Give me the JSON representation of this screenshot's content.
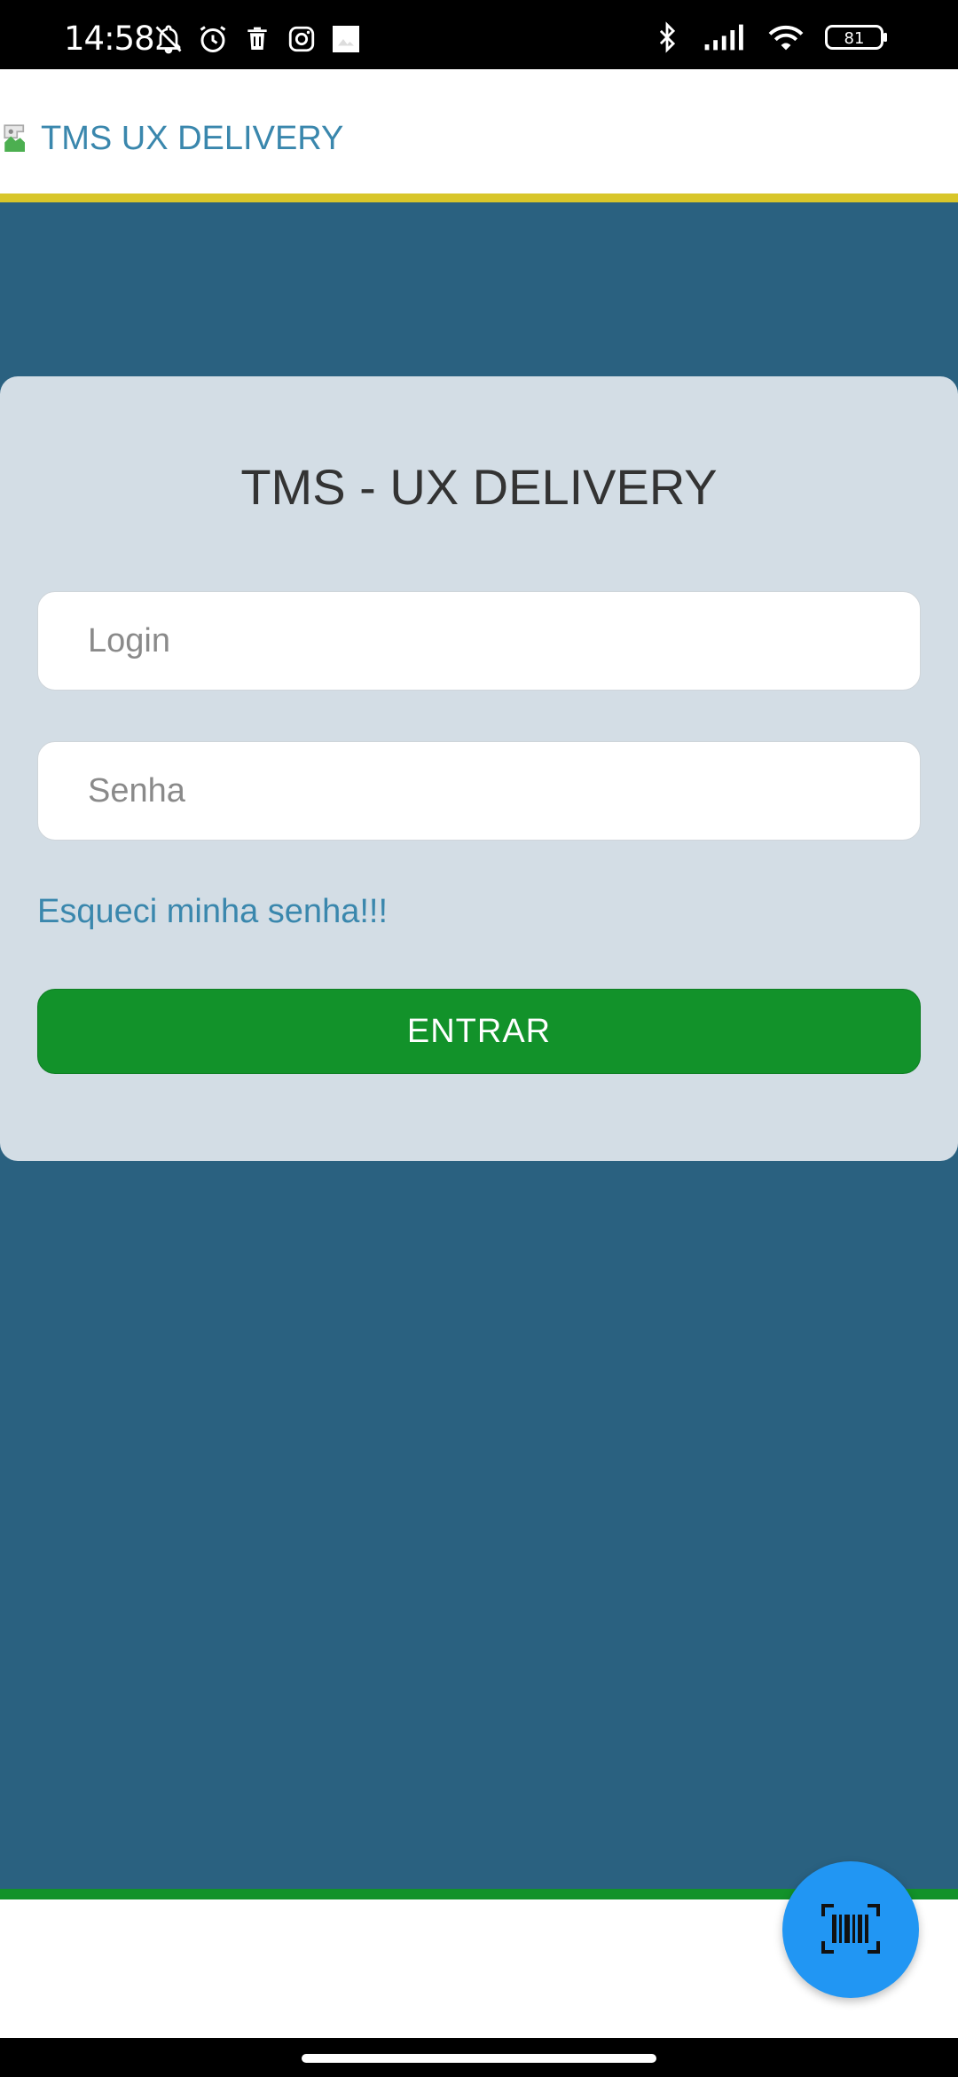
{
  "status_bar": {
    "time": "14:58",
    "battery": "81",
    "left_icons": [
      "notifications-off-icon",
      "alarm-icon",
      "trash-icon",
      "instagram-icon",
      "image-icon"
    ],
    "right_icons": [
      "bluetooth-icon",
      "signal-icon",
      "wifi-icon",
      "battery-icon"
    ]
  },
  "header": {
    "logo_alt": "TMS UX DELIVERY",
    "accent_color": "#d8c62a"
  },
  "login_card": {
    "title": "TMS - UX DELIVERY",
    "login_placeholder": "Login",
    "password_placeholder": "Senha",
    "forgot_password": "Esqueci minha senha!!!",
    "submit_label": "ENTRAR"
  },
  "fab": {
    "icon": "barcode-scan-icon",
    "color": "#2196f3"
  },
  "colors": {
    "background": "#2a6180",
    "card": "#d3dde5",
    "primary_button": "#12922a",
    "link": "#3a87ad"
  }
}
